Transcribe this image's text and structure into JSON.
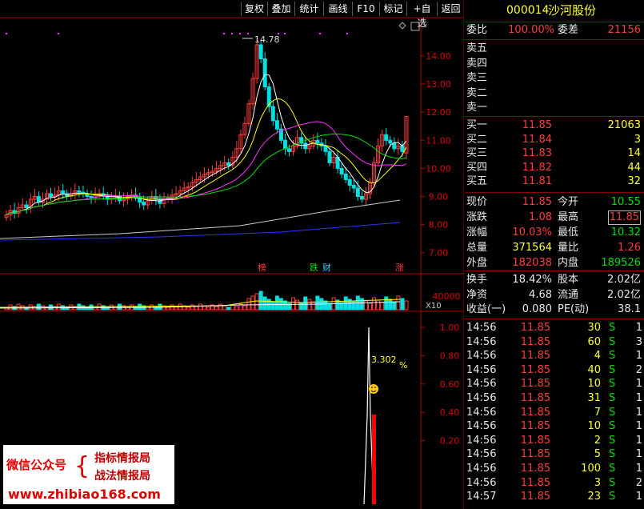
{
  "toolbar": {
    "buttons": [
      "复权",
      "叠加",
      "统计",
      "画线",
      "F10",
      "标记",
      "+自选",
      "返回"
    ]
  },
  "stock": {
    "code": "000014",
    "name": "沙河股份"
  },
  "orderbook": {
    "weibi_label": "委比",
    "weibi_value": "100.00%",
    "weicha_label": "委差",
    "weicha_value": "21156",
    "sells": [
      {
        "label": "卖五"
      },
      {
        "label": "卖四"
      },
      {
        "label": "卖三"
      },
      {
        "label": "卖二"
      },
      {
        "label": "卖一"
      }
    ],
    "buys": [
      {
        "label": "买一",
        "price": "11.85",
        "vol": "21063"
      },
      {
        "label": "买二",
        "price": "11.84",
        "vol": "3"
      },
      {
        "label": "买三",
        "price": "11.83",
        "vol": "14"
      },
      {
        "label": "买四",
        "price": "11.82",
        "vol": "44"
      },
      {
        "label": "买五",
        "price": "11.81",
        "vol": "32"
      }
    ]
  },
  "stats": [
    {
      "l1": "现价",
      "v1": "11.85",
      "l2": "今开",
      "v2": "10.55",
      "c1": "red",
      "c2": "green"
    },
    {
      "l1": "涨跌",
      "v1": "1.08",
      "l2": "最高",
      "v2": "11.85",
      "c1": "red",
      "c2": "red"
    },
    {
      "l1": "涨幅",
      "v1": "10.03%",
      "l2": "最低",
      "v2": "10.32",
      "c1": "red",
      "c2": "green"
    },
    {
      "l1": "总量",
      "v1": "371564",
      "l2": "量比",
      "v2": "1.26",
      "c1": "yellow",
      "c2": "red"
    },
    {
      "l1": "外盘",
      "v1": "182038",
      "l2": "内盘",
      "v2": "189526",
      "c1": "red",
      "c2": "green"
    }
  ],
  "stats2": [
    {
      "l1": "换手",
      "v1": "18.42%",
      "l2": "股本",
      "v2": "2.02亿"
    },
    {
      "l1": "净资",
      "v1": "4.68",
      "l2": "流通",
      "v2": "2.02亿"
    },
    {
      "l1": "收益(一)",
      "v1": "0.080",
      "l2": "PE(动)",
      "v2": "38.1"
    }
  ],
  "ticks": [
    {
      "t": "14:56",
      "p": "11.85",
      "v": "30",
      "s": "S",
      "n": "1"
    },
    {
      "t": "14:56",
      "p": "11.85",
      "v": "60",
      "s": "S",
      "n": "3"
    },
    {
      "t": "14:56",
      "p": "11.85",
      "v": "4",
      "s": "S",
      "n": "1"
    },
    {
      "t": "14:56",
      "p": "11.85",
      "v": "40",
      "s": "S",
      "n": "2"
    },
    {
      "t": "14:56",
      "p": "11.85",
      "v": "10",
      "s": "S",
      "n": "1"
    },
    {
      "t": "14:56",
      "p": "11.85",
      "v": "31",
      "s": "S",
      "n": "1"
    },
    {
      "t": "14:56",
      "p": "11.85",
      "v": "7",
      "s": "S",
      "n": "1"
    },
    {
      "t": "14:56",
      "p": "11.85",
      "v": "10",
      "s": "S",
      "n": "1"
    },
    {
      "t": "14:56",
      "p": "11.85",
      "v": "2",
      "s": "S",
      "n": "1"
    },
    {
      "t": "14:56",
      "p": "11.85",
      "v": "5",
      "s": "S",
      "n": "1"
    },
    {
      "t": "14:56",
      "p": "11.85",
      "v": "100",
      "s": "S",
      "n": "1"
    },
    {
      "t": "14:56",
      "p": "11.85",
      "v": "3",
      "s": "S",
      "n": "2"
    },
    {
      "t": "14:57",
      "p": "11.85",
      "v": "23",
      "s": "S",
      "n": "1"
    }
  ],
  "main_chart": {
    "price_axis": [
      "14.00",
      "13.00",
      "12.00",
      "11.00",
      "10.00",
      "9.00",
      "8.00",
      "7.00"
    ],
    "price_values": [
      14,
      13,
      12,
      11,
      10,
      9,
      8,
      7
    ],
    "high_label": "14.78",
    "badges": [
      {
        "t": "榜",
        "c": "#ff3b3b"
      },
      {
        "t": "跌",
        "c": "#00e000"
      },
      {
        "t": "财",
        "c": "#3cf"
      },
      {
        "t": "涨",
        "c": "#ff3b3b"
      }
    ]
  },
  "volume_chart": {
    "axis_label": "40000",
    "multiplier": "X10"
  },
  "indicator_chart": {
    "axis": [
      "1.00",
      "0.80",
      "0.60",
      "0.40",
      "0.20"
    ],
    "axis_values": [
      1.0,
      0.8,
      0.6,
      0.4,
      0.2
    ],
    "peak_label": "3.302",
    "percent_sign": "%"
  },
  "watermark": {
    "line1a": "微信公众号",
    "line1b": "指标情报局",
    "line2b": "战法情报局",
    "line3": "www.zhibiao168.com",
    "brace": "{"
  },
  "colors": {
    "up": "#ff3b3b",
    "down": "#00e0e0",
    "ma5": "#ffffff",
    "ma10": "#ffff00",
    "ma20": "#ff33ff",
    "ma30": "#00e000",
    "ma60": "#cccccc",
    "ma120": "#3333ff",
    "axis": "#aa0000"
  }
}
